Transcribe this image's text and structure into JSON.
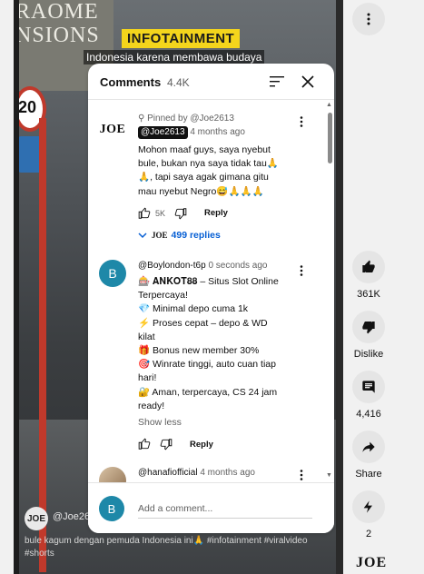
{
  "video": {
    "store_text_line1": "RAOME",
    "store_text_line2": "NSIONS",
    "sign_value": "20",
    "overlay_title": "INFOTAINMENT",
    "overlay_caption": "Indonesia karena membawa budaya",
    "channel_logo": "JOE",
    "channel_handle": "@Joe26",
    "description": "bule kagum dengan pemuda Indonesia ini🙏 #infotainment #viralvideo #shorts"
  },
  "actions": {
    "like_count": "361K",
    "dislike_label": "Dislike",
    "comments_count": "4,416",
    "share_label": "Share",
    "remix_count": "2",
    "brand": "JOE"
  },
  "panel": {
    "title": "Comments",
    "count": "4.4K"
  },
  "comments": [
    {
      "avatar": "JOE",
      "pinned": "Pinned by @Joe2613",
      "author": "@Joe2613",
      "time": "4 months ago",
      "text": "Mohon maaf guys, saya nyebut\nbule, bukan nya saya tidak tau🙏\n🙏, tapi saya agak gimana gitu\nmau nyebut Negro😅🙏🙏🙏",
      "likes": "5K",
      "reply_label": "Reply",
      "replies_logo": "JOE",
      "replies_label": "499 replies"
    },
    {
      "avatar": "B",
      "author": "@Boylondon-t6p",
      "time": "0 seconds ago",
      "text": "🎰 𝐀𝐍𝐊𝐎𝐓𝟖𝟖 – Situs Slot Online\nTerpercaya!\n💎 Minimal depo cuma 1k\n⚡ Proses cepat – depo & WD\nkilat\n🎁 Bonus new member 30%\n🎯 Winrate tinggi, auto cuan tiap\nhari!\n🔐 Aman, terpercaya, CS 24 jam\nready!",
      "show_less": "Show less",
      "reply_label": "Reply"
    },
    {
      "author": "@hanafiofficial",
      "time": "4 months ago"
    }
  ],
  "add_comment": {
    "avatar": "B",
    "placeholder": "Add a comment..."
  }
}
